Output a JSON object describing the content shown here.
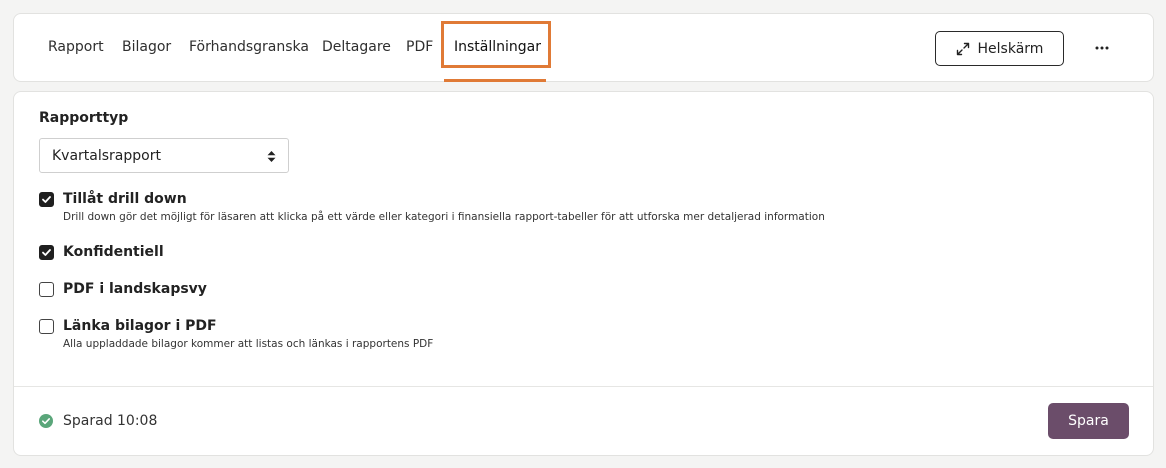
{
  "tabs": [
    {
      "label": "Rapport"
    },
    {
      "label": "Bilagor"
    },
    {
      "label": "Förhandsgranska"
    },
    {
      "label": "Deltagare"
    },
    {
      "label": "PDF"
    },
    {
      "label": "Inställningar",
      "active": true
    }
  ],
  "header": {
    "fullscreen_label": "Helskärm",
    "fullscreen_icon": "expand-arrows-icon",
    "more_icon": "more-horizontal-icon"
  },
  "settings": {
    "report_type_label": "Rapporttyp",
    "report_type_value": "Kvartalsrapport",
    "options": [
      {
        "label": "Tillåt drill down",
        "checked": true,
        "description": "Drill down gör det möjligt för läsaren att klicka på ett värde eller kategori i finansiella rapport-tabeller för att utforska mer detaljerad information"
      },
      {
        "label": "Konfidentiell",
        "checked": true
      },
      {
        "label": "PDF i landskapsvy",
        "checked": false
      },
      {
        "label": "Länka bilagor i PDF",
        "checked": false,
        "description": "Alla uppladdade bilagor kommer att listas och länkas i rapportens PDF"
      }
    ]
  },
  "footer": {
    "status_text": "Sparad 10:08",
    "status_icon": "check-circle-icon",
    "save_label": "Spara"
  },
  "colors": {
    "accent": "#e07a36",
    "primary_button": "#6b4d6a",
    "success": "#5aa67a"
  }
}
